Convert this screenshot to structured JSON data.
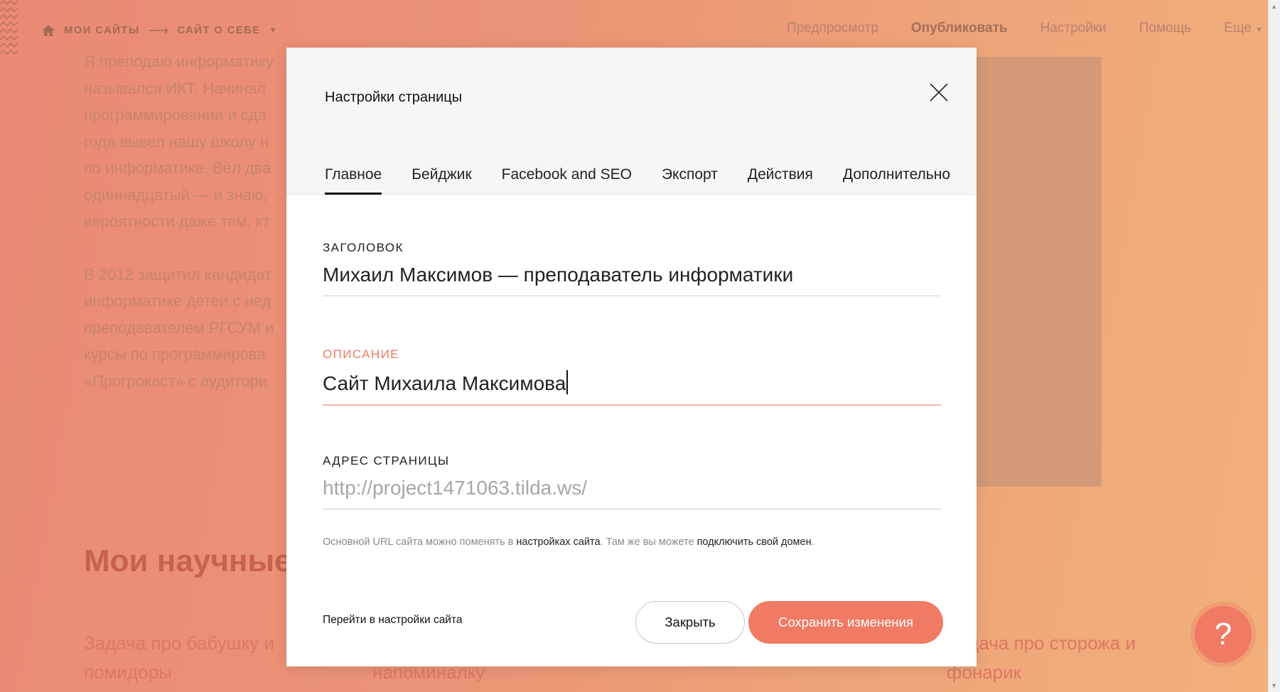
{
  "topbar": {
    "breadcrumb": [
      "МОИ САЙТЫ",
      "САЙТ О СЕБЕ"
    ],
    "breadcrumb_sep": "⟶",
    "nav": [
      "Предпросмотр",
      "Опубликовать",
      "Настройки",
      "Помощь",
      "Еще"
    ]
  },
  "background": {
    "bio_lines": [
      "Я преподаю информатику",
      "назывался ИКТ. Начинал",
      "программировании и сда",
      "года вывел нашу школу н",
      "по информатике. Вёл два",
      "одиннадцатый — и знаю,",
      "вероятности даже тем, кт"
    ],
    "bio_lines_2": [
      "В 2012 защитил кандидат",
      "информатике детей с нед",
      "преподавателем РГСУМ и",
      "курсы по программирова",
      "«Прогрокаст» с аудитори"
    ],
    "heading": "Мои научные",
    "links": [
      {
        "line1": "Задача про бабушку и",
        "line2": "помидоры"
      },
      {
        "line1": "",
        "line2": "напоминалку"
      },
      {
        "line1": "Задача про сторожа и",
        "line2": "фонарик"
      }
    ],
    "help_label": "?"
  },
  "modal": {
    "title": "Настройки страницы",
    "tabs": [
      "Главное",
      "Бейджик",
      "Facebook and SEO",
      "Экспорт",
      "Действия",
      "Дополнительно"
    ],
    "active_tab": 0,
    "fields": {
      "title_label": "ЗАГОЛОВОК",
      "title_value": "Михаил Максимов — преподаватель информатики",
      "description_label": "ОПИСАНИЕ",
      "description_value": "Сайт Михаила Максимова",
      "address_label": "АДРЕС СТРАНИЦЫ",
      "address_placeholder": "http://project1471063.tilda.ws/"
    },
    "hint": {
      "part1": "Основной URL сайта можно поменять в ",
      "link1": "настройках сайта",
      "part2": ". Там же вы можете ",
      "link2": "подключить свой домен",
      "part3": "."
    },
    "site_settings_link": "Перейти в настройки сайта",
    "close_button": "Закрыть",
    "save_button": "Сохранить изменения"
  },
  "colors": {
    "accent": "#f07a63",
    "background_gradient_start": "#e98a74",
    "background_gradient_end": "#f1b07c"
  }
}
